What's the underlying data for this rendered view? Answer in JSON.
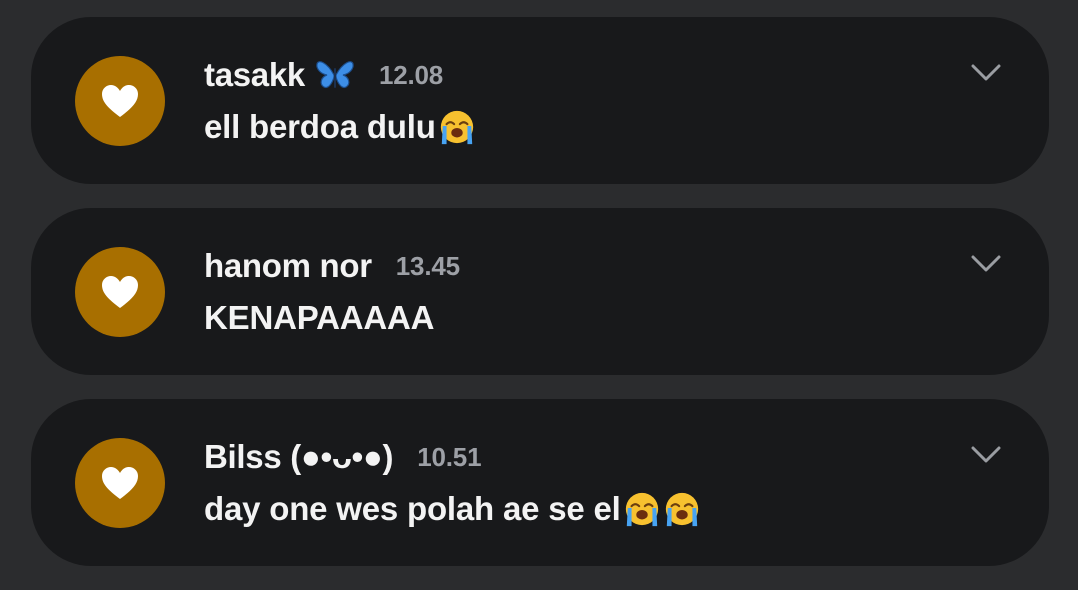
{
  "comments": [
    {
      "author": "tasakk",
      "author_badge_icon": "butterfly-icon",
      "time": "12.08",
      "text": "ell berdoa dulu",
      "emoji_icons": [
        "loudly-crying-face-icon"
      ]
    },
    {
      "author": "hanom nor",
      "time": "13.45",
      "text": "KENAPAAAAA",
      "emoji_icons": []
    },
    {
      "author": "Bilss (●•ᴗ•●)",
      "time": "10.51",
      "text": "day one wes polah ae se el",
      "emoji_icons": [
        "loudly-crying-face-icon",
        "loudly-crying-face-icon"
      ]
    }
  ],
  "colors": {
    "background": "#2b2c2e",
    "card": "#18191b",
    "avatar": "#a86f00",
    "time": "#9da0a6"
  }
}
